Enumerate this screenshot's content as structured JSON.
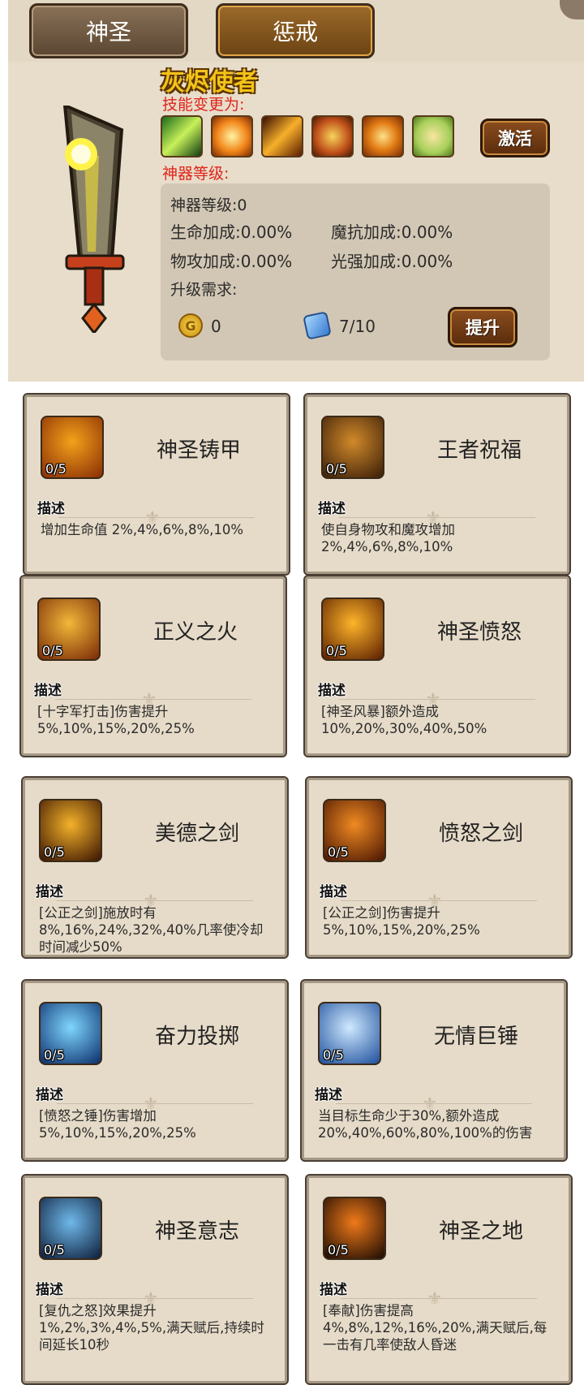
{
  "tabs": [
    {
      "label": "神圣",
      "active": false
    },
    {
      "label": "惩戒",
      "active": true
    }
  ],
  "hero": {
    "name": "灰烬使者",
    "skill_change_label": "技能变更为:",
    "artifact_level_label": "神器等级:",
    "activate_button": "激活"
  },
  "skill_icons": [
    "green-slash-icon",
    "fire-burst-icon",
    "fire-staff-icon",
    "holy-shield-fire-icon",
    "fire-swirl-icon",
    "holy-shield-green-icon"
  ],
  "stats": {
    "level": "神器等级:0",
    "hp_bonus": "生命加成:0.00%",
    "mres_bonus": "魔抗加成:0.00%",
    "atk_bonus": "物攻加成:0.00%",
    "light_bonus": "光强加成:0.00%",
    "upgrade_req_label": "升级需求:",
    "gold": "0",
    "gem": "7/10",
    "upgrade_button": "提升"
  },
  "talents": [
    {
      "name": "神圣铸甲",
      "level": "0/5",
      "desc_label": "描述",
      "desc": "增加生命值 2%,4%,6%,8%,10%",
      "icon": "golden-shield-icon",
      "c1": "#f3a21a",
      "c2": "#8a2d05"
    },
    {
      "name": "王者祝福",
      "level": "0/5",
      "desc_label": "描述",
      "desc": "使自身物攻和魔攻增加 2%,4%,6%,8%,10%",
      "icon": "crossed-swords-icon",
      "c1": "#d18a2a",
      "c2": "#3a1d08"
    },
    {
      "name": "正义之火",
      "level": "0/5",
      "desc_label": "描述",
      "desc": "[十字军打击]伤害提升5%,10%,15%,20%,25%",
      "icon": "flaming-blade-icon",
      "c1": "#f2b83a",
      "c2": "#7a2a05"
    },
    {
      "name": "神圣愤怒",
      "level": "0/5",
      "desc_label": "描述",
      "desc": "[神圣风暴]额外造成 10%,20%,30%,40%,50%",
      "icon": "flame-burst-icon",
      "c1": "#ffb52a",
      "c2": "#5a1e00"
    },
    {
      "name": "美德之剑",
      "level": "0/5",
      "desc_label": "描述",
      "desc": "[公正之剑]施放时有8%,16%,24%,32%,40%几率使冷却时间减少50%",
      "icon": "glowing-sword-icon",
      "c1": "#f4b22a",
      "c2": "#3a1402"
    },
    {
      "name": "愤怒之剑",
      "level": "0/5",
      "desc_label": "描述",
      "desc": "[公正之剑]伤害提升5%,10%,15%,20%,25%",
      "icon": "flame-sword-icon",
      "c1": "#f08a22",
      "c2": "#4a1602"
    },
    {
      "name": "奋力投掷",
      "level": "0/5",
      "desc_label": "描述",
      "desc": "[愤怒之锤]伤害增加5%,10%,15%,20%,25%",
      "icon": "hammer-throw-icon",
      "c1": "#7fd6ff",
      "c2": "#0a2e6a"
    },
    {
      "name": "无情巨锤",
      "level": "0/5",
      "desc_label": "描述",
      "desc": "当目标生命少于30%,额外造成20%,40%,60%,80%,100%的伤害",
      "icon": "lightning-hammer-icon",
      "c1": "#cfe9ff",
      "c2": "#1d4f9c"
    },
    {
      "name": "神圣意志",
      "level": "0/5",
      "desc_label": "描述",
      "desc": "[复仇之怒]效果提升1%,2%,3%,4%,5%,满天赋后,持续时间延长10秒",
      "icon": "winged-shield-icon",
      "c1": "#6fb9ea",
      "c2": "#0d1d3a"
    },
    {
      "name": "神圣之地",
      "level": "0/5",
      "desc_label": "描述",
      "desc": "[奉献]伤害提高4%,8%,12%,16%,20%,满天赋后,每一击有几率使敌人昏迷",
      "icon": "fire-streak-icon",
      "c1": "#f07a1a",
      "c2": "#1a0a02"
    }
  ]
}
